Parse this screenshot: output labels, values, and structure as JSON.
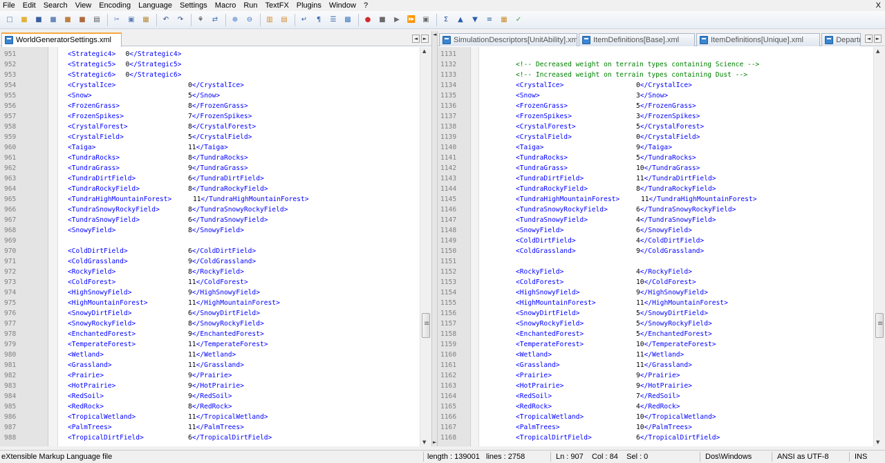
{
  "menu": [
    "File",
    "Edit",
    "Search",
    "View",
    "Encoding",
    "Language",
    "Settings",
    "Macro",
    "Run",
    "TextFX",
    "Plugins",
    "Window",
    "?"
  ],
  "close_glyph": "X",
  "toolbar_icons": [
    {
      "name": "new-file-icon",
      "glyph": "□",
      "color": "#5a7fb0"
    },
    {
      "name": "open-file-icon",
      "glyph": "■",
      "color": "#e3b23c"
    },
    {
      "name": "save-icon",
      "glyph": "■",
      "color": "#3a5f9f"
    },
    {
      "name": "save-all-icon",
      "glyph": "■",
      "color": "#6b8ab8"
    },
    {
      "name": "close-icon",
      "glyph": "■",
      "color": "#c08040"
    },
    {
      "name": "close-all-icon",
      "glyph": "■",
      "color": "#b06a40"
    },
    {
      "name": "print-icon",
      "glyph": "▤",
      "color": "#555555"
    },
    {
      "sep": true
    },
    {
      "name": "cut-icon",
      "glyph": "✂",
      "color": "#6d8bc4"
    },
    {
      "name": "copy-icon",
      "glyph": "▣",
      "color": "#5b7fb3"
    },
    {
      "name": "paste-icon",
      "glyph": "▦",
      "color": "#b88a3c"
    },
    {
      "sep": true
    },
    {
      "name": "undo-icon",
      "glyph": "↶",
      "color": "#2b4b86"
    },
    {
      "name": "redo-icon",
      "glyph": "↷",
      "color": "#2b4b86"
    },
    {
      "sep": true
    },
    {
      "name": "find-icon",
      "glyph": "⚘",
      "color": "#333333"
    },
    {
      "name": "replace-icon",
      "glyph": "⇄",
      "color": "#3e6fb2"
    },
    {
      "sep": true
    },
    {
      "name": "zoom-in-icon",
      "glyph": "⊕",
      "color": "#2f6fbf"
    },
    {
      "name": "zoom-out-icon",
      "glyph": "⊖",
      "color": "#2f6fbf"
    },
    {
      "sep": true
    },
    {
      "name": "sync-vertical-icon",
      "glyph": "▥",
      "color": "#d88a2c"
    },
    {
      "name": "sync-horizontal-icon",
      "glyph": "▤",
      "color": "#d88a2c"
    },
    {
      "sep": true
    },
    {
      "name": "word-wrap-icon",
      "glyph": "↵",
      "color": "#2a5ea8"
    },
    {
      "name": "show-all-chars-icon",
      "glyph": "¶",
      "color": "#2a5ea8"
    },
    {
      "name": "indent-guide-icon",
      "glyph": "☰",
      "color": "#2a5ea8"
    },
    {
      "name": "user-lang-icon",
      "glyph": "▩",
      "color": "#3d78c3"
    },
    {
      "sep": true
    },
    {
      "name": "record-macro-icon",
      "glyph": "●",
      "color": "#d42a2a"
    },
    {
      "name": "stop-macro-icon",
      "glyph": "■",
      "color": "#6a6a6a"
    },
    {
      "name": "play-macro-icon",
      "glyph": "▶",
      "color": "#6a6a6a"
    },
    {
      "name": "run-macro-multiple-icon",
      "glyph": "⏩",
      "color": "#6a6a6a"
    },
    {
      "name": "save-macro-icon",
      "glyph": "▣",
      "color": "#6a6a6a"
    },
    {
      "sep": true
    },
    {
      "name": "sort-icon",
      "glyph": "Σ",
      "color": "#2455a5"
    },
    {
      "name": "move-up-icon",
      "glyph": "▲",
      "color": "#2a5ea8"
    },
    {
      "name": "move-down-icon",
      "glyph": "▼",
      "color": "#2a5ea8"
    },
    {
      "name": "sum-icon",
      "glyph": "≡",
      "color": "#2a5ea8"
    },
    {
      "name": "compare-icon",
      "glyph": "▦",
      "color": "#c98b2a"
    },
    {
      "name": "spellcheck-icon",
      "glyph": "✓",
      "color": "#3c9a3c"
    }
  ],
  "left_tabs": [
    {
      "label": "WorldGeneratorSettings.xml",
      "active": true
    }
  ],
  "right_tabs": [
    {
      "label": "SimulationDescriptors[UnitAbility].xml",
      "active": false
    },
    {
      "label": "ItemDefinitions[Base].xml",
      "active": false
    },
    {
      "label": "ItemDefinitions[Unique].xml",
      "active": false
    },
    {
      "label": "DepartmentOfScience+Co",
      "active": false
    }
  ],
  "left_lines": [
    {
      "n": "951",
      "tag": "<Strategic4>",
      "val": "0",
      "close": "</Strategic4>",
      "inline": true
    },
    {
      "n": "952",
      "tag": "<Strategic5>",
      "val": "0",
      "close": "</Strategic5>",
      "inline": true
    },
    {
      "n": "953",
      "tag": "<Strategic6>",
      "val": "0",
      "close": "</Strategic6>",
      "inline": true
    },
    {
      "n": "954",
      "tag": "<CrystalIce>",
      "val": "0",
      "close": "</CrystalIce>"
    },
    {
      "n": "955",
      "tag": "<Snow>",
      "val": "5",
      "close": "</Snow>"
    },
    {
      "n": "956",
      "tag": "<FrozenGrass>",
      "val": "8",
      "close": "</FrozenGrass>"
    },
    {
      "n": "957",
      "tag": "<FrozenSpikes>",
      "val": "7",
      "close": "</FrozenSpikes>"
    },
    {
      "n": "958",
      "tag": "<CrystalForest>",
      "val": "8",
      "close": "</CrystalForest>"
    },
    {
      "n": "959",
      "tag": "<CrystalField>",
      "val": "5",
      "close": "</CrystalField>"
    },
    {
      "n": "960",
      "tag": "<Taiga>",
      "val": "11",
      "close": "</Taiga>"
    },
    {
      "n": "961",
      "tag": "<TundraRocks>",
      "val": "8",
      "close": "</TundraRocks>"
    },
    {
      "n": "962",
      "tag": "<TundraGrass>",
      "val": "9",
      "close": "</TundraGrass>"
    },
    {
      "n": "963",
      "tag": "<TundraDirtField>",
      "val": "6",
      "close": "</TundraDirtField>"
    },
    {
      "n": "964",
      "tag": "<TundraRockyField>",
      "val": "8",
      "close": "</TundraRockyField>"
    },
    {
      "n": "965",
      "tag": "<TundraHighMountainForest>",
      "val": "11",
      "close": "</TundraHighMountainForest>"
    },
    {
      "n": "966",
      "tag": "<TundraSnowyRockyField>",
      "val": "8",
      "close": "</TundraSnowyRockyField>"
    },
    {
      "n": "967",
      "tag": "<TundraSnowyField>",
      "val": "6",
      "close": "</TundraSnowyField>"
    },
    {
      "n": "968",
      "tag": "<SnowyField>",
      "val": "8",
      "close": "</SnowyField>"
    },
    {
      "n": "969",
      "tag": "",
      "val": "",
      "close": ""
    },
    {
      "n": "970",
      "tag": "<ColdDirtField>",
      "val": "6",
      "close": "</ColdDirtField>"
    },
    {
      "n": "971",
      "tag": "<ColdGrassland>",
      "val": "9",
      "close": "</ColdGrassland>"
    },
    {
      "n": "972",
      "tag": "<RockyField>",
      "val": "8",
      "close": "</RockyField>"
    },
    {
      "n": "973",
      "tag": "<ColdForest>",
      "val": "11",
      "close": "</ColdForest>"
    },
    {
      "n": "974",
      "tag": "<HighSnowyField>",
      "val": "9",
      "close": "</HighSnowyField>"
    },
    {
      "n": "975",
      "tag": "<HighMountainForest>",
      "val": "11",
      "close": "</HighMountainForest>"
    },
    {
      "n": "976",
      "tag": "<SnowyDirtField>",
      "val": "6",
      "close": "</SnowyDirtField>"
    },
    {
      "n": "977",
      "tag": "<SnowyRockyField>",
      "val": "8",
      "close": "</SnowyRockyField>"
    },
    {
      "n": "978",
      "tag": "<EnchantedForest>",
      "val": "9",
      "close": "</EnchantedForest>"
    },
    {
      "n": "979",
      "tag": "<TemperateForest>",
      "val": "11",
      "close": "</TemperateForest>"
    },
    {
      "n": "980",
      "tag": "<Wetland>",
      "val": "11",
      "close": "</Wetland>"
    },
    {
      "n": "981",
      "tag": "<Grassland>",
      "val": "11",
      "close": "</Grassland>"
    },
    {
      "n": "982",
      "tag": "<Prairie>",
      "val": "9",
      "close": "</Prairie>"
    },
    {
      "n": "983",
      "tag": "<HotPrairie>",
      "val": "9",
      "close": "</HotPrairie>"
    },
    {
      "n": "984",
      "tag": "<RedSoil>",
      "val": "9",
      "close": "</RedSoil>"
    },
    {
      "n": "985",
      "tag": "<RedRock>",
      "val": "8",
      "close": "</RedRock>"
    },
    {
      "n": "986",
      "tag": "<TropicalWetland>",
      "val": "11",
      "close": "</TropicalWetland>"
    },
    {
      "n": "987",
      "tag": "<PalmTrees>",
      "val": "11",
      "close": "</PalmTrees>"
    },
    {
      "n": "988",
      "tag": "<TropicalDirtField>",
      "val": "6",
      "close": "</TropicalDirtField>"
    }
  ],
  "right_lines": [
    {
      "n": "1131",
      "tag": "",
      "val": "",
      "close": ""
    },
    {
      "n": "1132",
      "comment": "<!-- Decreased weight on terrain types containing Science -->"
    },
    {
      "n": "1133",
      "comment": "<!-- Increased weight on terrain types containing Dust -->"
    },
    {
      "n": "1134",
      "tag": "<CrystalIce>",
      "val": "0",
      "close": "</CrystalIce>"
    },
    {
      "n": "1135",
      "tag": "<Snow>",
      "val": "3",
      "close": "</Snow>"
    },
    {
      "n": "1136",
      "tag": "<FrozenGrass>",
      "val": "5",
      "close": "</FrozenGrass>"
    },
    {
      "n": "1137",
      "tag": "<FrozenSpikes>",
      "val": "3",
      "close": "</FrozenSpikes>"
    },
    {
      "n": "1138",
      "tag": "<CrystalForest>",
      "val": "5",
      "close": "</CrystalForest>"
    },
    {
      "n": "1139",
      "tag": "<CrystalField>",
      "val": "0",
      "close": "</CrystalField>"
    },
    {
      "n": "1140",
      "tag": "<Taiga>",
      "val": "9",
      "close": "</Taiga>"
    },
    {
      "n": "1141",
      "tag": "<TundraRocks>",
      "val": "5",
      "close": "</TundraRocks>"
    },
    {
      "n": "1142",
      "tag": "<TundraGrass>",
      "val": "10",
      "close": "</TundraGrass>"
    },
    {
      "n": "1143",
      "tag": "<TundraDirtField>",
      "val": "11",
      "close": "</TundraDirtField>"
    },
    {
      "n": "1144",
      "tag": "<TundraRockyField>",
      "val": "8",
      "close": "</TundraRockyField>"
    },
    {
      "n": "1145",
      "tag": "<TundraHighMountainForest>",
      "val": "11",
      "close": "</TundraHighMountainForest>"
    },
    {
      "n": "1146",
      "tag": "<TundraSnowyRockyField>",
      "val": "6",
      "close": "</TundraSnowyRockyField>"
    },
    {
      "n": "1147",
      "tag": "<TundraSnowyField>",
      "val": "4",
      "close": "</TundraSnowyField>"
    },
    {
      "n": "1148",
      "tag": "<SnowyField>",
      "val": "6",
      "close": "</SnowyField>"
    },
    {
      "n": "1149",
      "tag": "<ColdDirtField>",
      "val": "4",
      "close": "</ColdDirtField>"
    },
    {
      "n": "1150",
      "tag": "<ColdGrassland>",
      "val": "9",
      "close": "</ColdGrassland>"
    },
    {
      "n": "1151",
      "tag": "",
      "val": "",
      "close": ""
    },
    {
      "n": "1152",
      "tag": "<RockyField>",
      "val": "4",
      "close": "</RockyField>"
    },
    {
      "n": "1153",
      "tag": "<ColdForest>",
      "val": "10",
      "close": "</ColdForest>"
    },
    {
      "n": "1154",
      "tag": "<HighSnowyField>",
      "val": "9",
      "close": "</HighSnowyField>"
    },
    {
      "n": "1155",
      "tag": "<HighMountainForest>",
      "val": "11",
      "close": "</HighMountainForest>"
    },
    {
      "n": "1156",
      "tag": "<SnowyDirtField>",
      "val": "5",
      "close": "</SnowyDirtField>"
    },
    {
      "n": "1157",
      "tag": "<SnowyRockyField>",
      "val": "5",
      "close": "</SnowyRockyField>"
    },
    {
      "n": "1158",
      "tag": "<EnchantedForest>",
      "val": "5",
      "close": "</EnchantedForest>"
    },
    {
      "n": "1159",
      "tag": "<TemperateForest>",
      "val": "10",
      "close": "</TemperateForest>"
    },
    {
      "n": "1160",
      "tag": "<Wetland>",
      "val": "11",
      "close": "</Wetland>"
    },
    {
      "n": "1161",
      "tag": "<Grassland>",
      "val": "11",
      "close": "</Grassland>"
    },
    {
      "n": "1162",
      "tag": "<Prairie>",
      "val": "9",
      "close": "</Prairie>"
    },
    {
      "n": "1163",
      "tag": "<HotPrairie>",
      "val": "9",
      "close": "</HotPrairie>"
    },
    {
      "n": "1164",
      "tag": "<RedSoil>",
      "val": "7",
      "close": "</RedSoil>"
    },
    {
      "n": "1165",
      "tag": "<RedRock>",
      "val": "4",
      "close": "</RedRock>"
    },
    {
      "n": "1166",
      "tag": "<TropicalWetland>",
      "val": "10",
      "close": "</TropicalWetland>"
    },
    {
      "n": "1167",
      "tag": "<PalmTrees>",
      "val": "10",
      "close": "</PalmTrees>"
    },
    {
      "n": "1168",
      "tag": "<TropicalDirtField>",
      "val": "6",
      "close": "</TropicalDirtField>"
    }
  ],
  "status": {
    "file_type": "eXtensible Markup Language file",
    "length": "length : 139001",
    "lines": "lines : 2758",
    "position": "Ln : 907    Col : 84    Sel : 0",
    "eol": "Dos\\Windows",
    "encoding": "ANSI as UTF-8",
    "mode": "INS"
  },
  "colors": {
    "tag": "#0000ff",
    "value": "#000000",
    "comment": "#008000",
    "line_number": "#808080",
    "active_tab_accent": "#f9a640"
  },
  "scroll": {
    "left_thumb_fraction": 0.72,
    "right_thumb_fraction": 0.72
  },
  "scroll_glyphs": {
    "up": "▲",
    "down": "▼"
  },
  "nav_glyphs": {
    "prev": "◄",
    "next": "►"
  }
}
